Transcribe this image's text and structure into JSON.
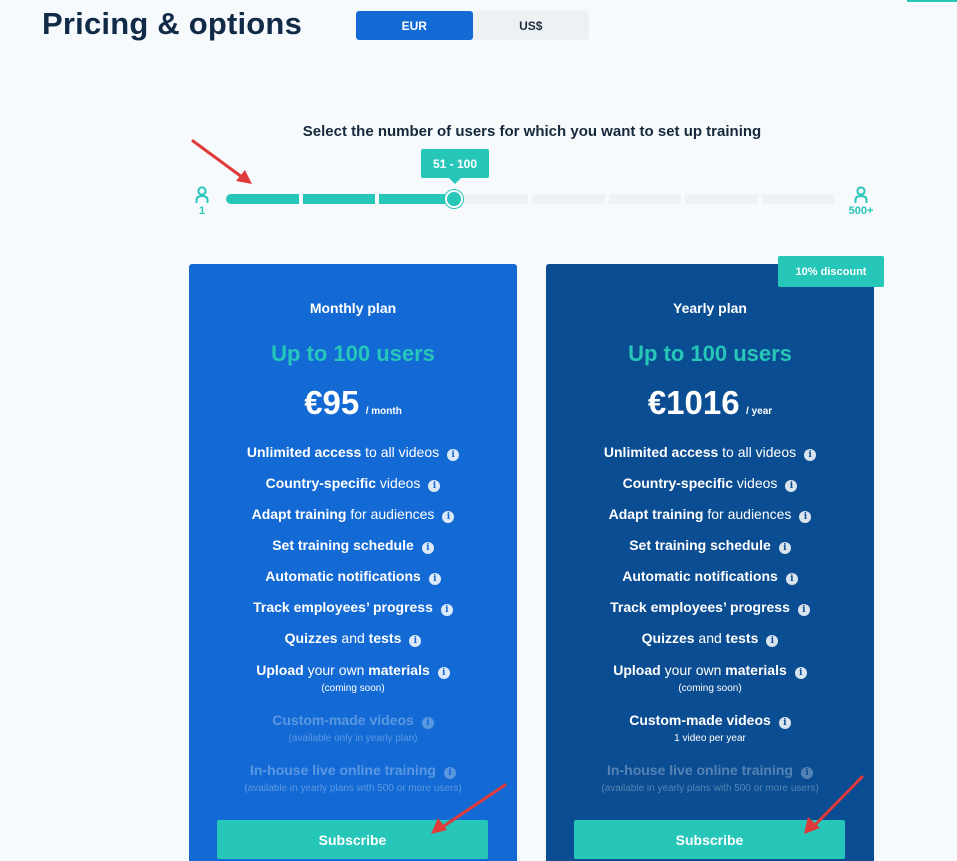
{
  "header": {
    "title": "Pricing & options"
  },
  "currency": {
    "options": [
      "EUR",
      "US$"
    ],
    "selected": "EUR"
  },
  "slider": {
    "heading": "Select the number of users for which you want to set up training",
    "tooltip": "51 - 100",
    "min_label": "1",
    "max_label": "500+",
    "segments_total": 8,
    "segments_filled": 3,
    "value_fraction": 0.375
  },
  "colors": {
    "accent": "#26c6b9",
    "monthly_bg": "#136ad5",
    "yearly_bg": "#0b4d92",
    "annotation_arrow": "#e03a3a"
  },
  "plans": {
    "monthly": {
      "name": "Monthly plan",
      "users": "Up to 100 users",
      "price": "€95",
      "period": "/ month",
      "subscribe_label": "Subscribe",
      "features": [
        {
          "bold": "Unlimited access",
          "rest": " to all videos"
        },
        {
          "bold": "Country-specific",
          "rest": " videos"
        },
        {
          "bold": "Adapt training",
          "rest": " for audiences"
        },
        {
          "bold": "Set training schedule",
          "rest": ""
        },
        {
          "bold": "Automatic notifications",
          "rest": ""
        },
        {
          "bold": "Track employees’ progress",
          "rest": ""
        },
        {
          "bold": "Quizzes",
          "rest": " and ",
          "bold2": "tests"
        },
        {
          "bold": "Upload",
          "rest": " your own ",
          "bold2": "materials",
          "note": "(coming soon)"
        },
        {
          "bold": "Custom-made videos",
          "rest": "",
          "note": "(available only in yearly plan)",
          "disabled": true
        },
        {
          "bold": "In-house live online training",
          "rest": "",
          "note": "(available in yearly plans with 500 or more users)",
          "disabled": true
        }
      ]
    },
    "yearly": {
      "name": "Yearly plan",
      "users": "Up to 100 users",
      "price": "€1016",
      "period": "/ year",
      "badge": "10% discount",
      "subscribe_label": "Subscribe",
      "features": [
        {
          "bold": "Unlimited access",
          "rest": " to all videos"
        },
        {
          "bold": "Country-specific",
          "rest": " videos"
        },
        {
          "bold": "Adapt training",
          "rest": " for audiences"
        },
        {
          "bold": "Set training schedule",
          "rest": ""
        },
        {
          "bold": "Automatic notifications",
          "rest": ""
        },
        {
          "bold": "Track employees’ progress",
          "rest": ""
        },
        {
          "bold": "Quizzes",
          "rest": " and ",
          "bold2": "tests"
        },
        {
          "bold": "Upload",
          "rest": " your own ",
          "bold2": "materials",
          "note": "(coming soon)"
        },
        {
          "bold": "Custom-made videos",
          "rest": "",
          "note": "1 video per year"
        },
        {
          "bold": "In-house live online training",
          "rest": "",
          "note": "(available in yearly plans with 500 or more users)",
          "disabled": true
        }
      ]
    }
  }
}
